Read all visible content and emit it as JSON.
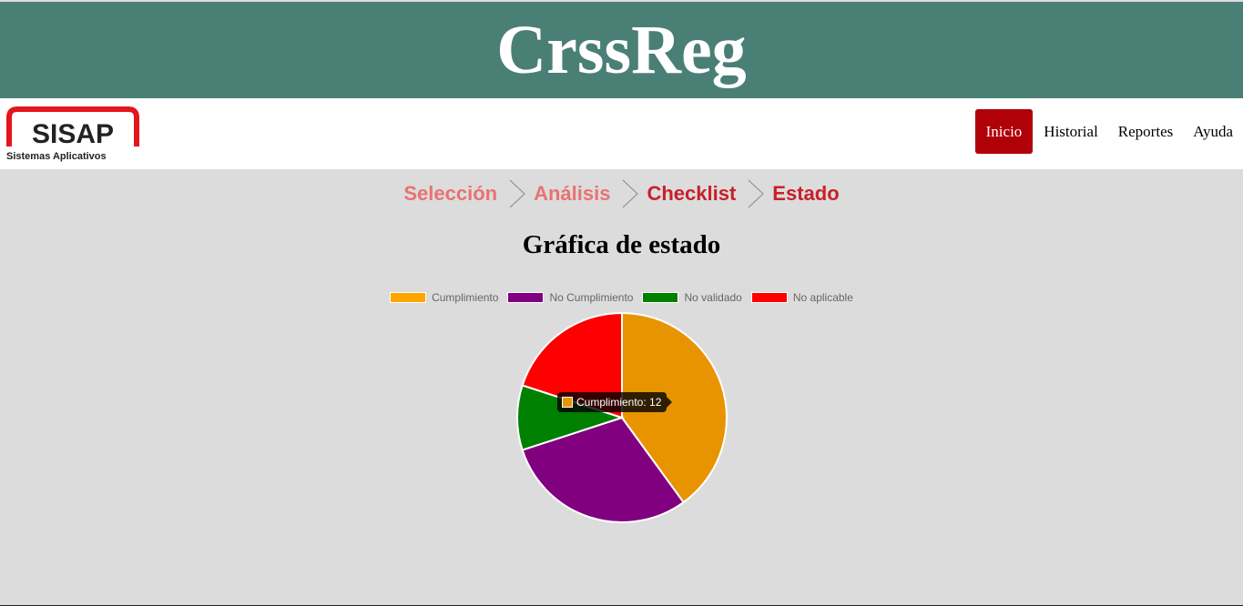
{
  "app": {
    "title": "CrssReg"
  },
  "brand": {
    "name": "SISAP",
    "tagline": "Sistemas Aplicativos",
    "colors": {
      "red": "#e3161c",
      "dark": "#222222"
    }
  },
  "nav": {
    "items": [
      {
        "label": "Inicio",
        "active": true
      },
      {
        "label": "Historial",
        "active": false
      },
      {
        "label": "Reportes",
        "active": false
      },
      {
        "label": "Ayuda",
        "active": false
      }
    ],
    "active_color": "#b00008"
  },
  "steps": [
    {
      "label": "Selección",
      "state": "done"
    },
    {
      "label": "Análisis",
      "state": "done"
    },
    {
      "label": "Checklist",
      "state": "current"
    },
    {
      "label": "Estado",
      "state": "current"
    }
  ],
  "page": {
    "title": "Gráfica de estado"
  },
  "tooltip": {
    "label": "Cumplimiento",
    "value": 12,
    "text": "Cumplimiento: 12"
  },
  "chart_data": {
    "type": "pie",
    "title": "",
    "legend": "top",
    "legend_items": [
      {
        "label": "Cumplimiento",
        "color": "#ffa500"
      },
      {
        "label": "No Cumplimiento",
        "color": "#800080"
      },
      {
        "label": "No validado",
        "color": "#008000"
      },
      {
        "label": "No aplicable",
        "color": "#ff0000"
      }
    ],
    "slices": [
      {
        "label": "Cumplimiento",
        "value": 12,
        "color": "#e89400"
      },
      {
        "label": "No Cumplimiento",
        "value": 9,
        "color": "#800080"
      },
      {
        "label": "No validado",
        "value": 3,
        "color": "#008000"
      },
      {
        "label": "No aplicable",
        "value": 6,
        "color": "#ff0000"
      }
    ]
  }
}
